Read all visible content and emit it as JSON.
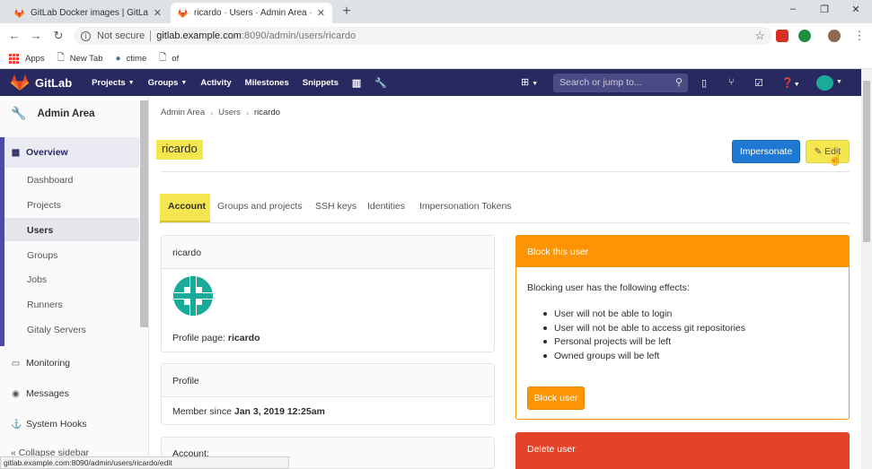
{
  "browser": {
    "tabs": [
      {
        "label": "GitLab Docker images | GitLab",
        "active": false
      },
      {
        "label": "ricardo · Users · Admin Area · GitL",
        "active": true
      }
    ],
    "new_tab": "+",
    "window_controls": [
      "–",
      "❐",
      "✕"
    ],
    "address": {
      "security": "Not secure",
      "host": "gitlab.example.com",
      "path": ":8090/admin/users/ricardo"
    },
    "bookmarks": [
      {
        "label": "Apps",
        "icon": "apps-grid-icon"
      },
      {
        "label": "New Tab",
        "icon": "page-icon"
      },
      {
        "label": "ctime",
        "icon": "python-icon"
      },
      {
        "label": "of",
        "icon": "page-icon"
      }
    ],
    "status_url": "gitlab.example.com:8090/admin/users/ricardo/edit"
  },
  "gitlab": {
    "brand": "GitLab",
    "nav": [
      {
        "label": "Projects",
        "dropdown": true
      },
      {
        "label": "Groups",
        "dropdown": true
      },
      {
        "label": "Activity",
        "dropdown": false
      },
      {
        "label": "Milestones",
        "dropdown": false
      },
      {
        "label": "Snippets",
        "dropdown": false
      }
    ],
    "search_placeholder": "Search or jump to..."
  },
  "sidebar": {
    "title": "Admin Area",
    "overview": "Overview",
    "sub_items": [
      "Dashboard",
      "Projects",
      "Users",
      "Groups",
      "Jobs",
      "Runners",
      "Gitaly Servers"
    ],
    "active_item": "Users",
    "main_items": [
      {
        "label": "Monitoring",
        "icon": "monitor-icon"
      },
      {
        "label": "Messages",
        "icon": "broadcast-icon"
      },
      {
        "label": "System Hooks",
        "icon": "hook-icon"
      }
    ],
    "collapse": "Collapse sidebar"
  },
  "breadcrumb": [
    "Admin Area",
    "Users",
    "ricardo"
  ],
  "page_title": "ricardo",
  "buttons": {
    "impersonate": "Impersonate",
    "edit": "Edit",
    "block": "Block user"
  },
  "tabs": [
    "Account",
    "Groups and projects",
    "SSH keys",
    "Identities",
    "Impersonation Tokens"
  ],
  "account_card": {
    "username": "ricardo",
    "profile_page_label": "Profile page:",
    "profile_page_value": "ricardo"
  },
  "profile_card": {
    "header": "Profile",
    "member_since_label": "Member since",
    "member_since_value": "Jan 3, 2019 12:25am",
    "next_header": "Account:"
  },
  "block_card": {
    "header": "Block this user",
    "intro": "Blocking user has the following effects:",
    "effects": [
      "User will not be able to login",
      "User will not be able to access git repositories",
      "Personal projects will be left",
      "Owned groups will be left"
    ]
  },
  "delete_card": {
    "header": "Delete user"
  },
  "colors": {
    "header_bg": "#292961",
    "highlight": "#f5e54f",
    "primary": "#1f78d1",
    "warning": "#fc9403",
    "danger": "#e24329",
    "avatar": "#1aaa9a"
  }
}
